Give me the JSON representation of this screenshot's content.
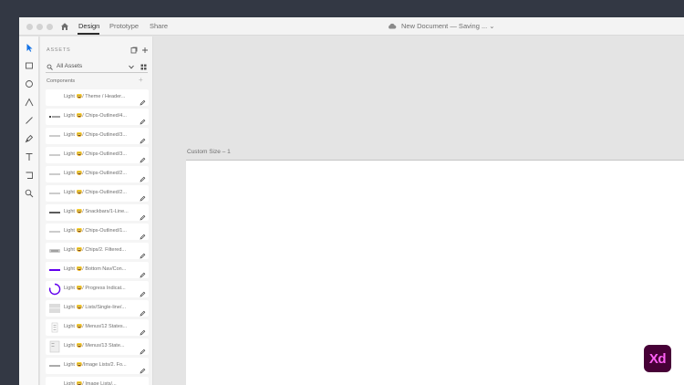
{
  "window": {
    "tabs": [
      {
        "label": "Design",
        "active": true
      },
      {
        "label": "Prototype",
        "active": false
      },
      {
        "label": "Share",
        "active": false
      }
    ],
    "document_title": "New Document  —  Saving ...  ⌄"
  },
  "assets": {
    "title": "ASSETS",
    "search_value": "All Assets",
    "components_heading": "Components",
    "components_add": "+",
    "items": [
      {
        "label": "Light 😀/ Theme / Header...",
        "thumb": "blank"
      },
      {
        "label": "Light 😀/ Chips-Outlined/4...",
        "thumb": "chip-dark"
      },
      {
        "label": "Light 😀/ Chips-Outlined/3...",
        "thumb": "chip-light"
      },
      {
        "label": "Light 😀/ Chips-Outlined/3...",
        "thumb": "chip-light"
      },
      {
        "label": "Light 😀/ Chips-Outlined/2...",
        "thumb": "chip-light"
      },
      {
        "label": "Light 😀/ Chips-Outlined/2...",
        "thumb": "chip-light"
      },
      {
        "label": "Light 😀/ Snackbars/1-Line...",
        "thumb": "bar-dark"
      },
      {
        "label": "Light 😀/ Chips-Outlined/1...",
        "thumb": "chip-light"
      },
      {
        "label": "Light 😀/ Chips/2. Filtered...",
        "thumb": "chip-filled"
      },
      {
        "label": "Light 😀/ Bottom Nav/Con...",
        "thumb": "bar-purple"
      },
      {
        "label": "Light 😀/ Progress Indicat...",
        "thumb": "progress"
      },
      {
        "label": "Light 😀/ Lists/Single-line/...",
        "thumb": "list"
      },
      {
        "label": "Light 😀/ Menus/12 States...",
        "thumb": "menu"
      },
      {
        "label": "Light 😀/ Menus/13 State...",
        "thumb": "menu2"
      },
      {
        "label": "Light 😀/Image Lists/2. Fo...",
        "thumb": "line-dark"
      },
      {
        "label": "Light 😀/ Image Lists/...",
        "thumb": "blank"
      }
    ]
  },
  "canvas": {
    "artboard_label": "Custom Size – 1"
  },
  "colors": {
    "accent": "#1473e6",
    "purple": "#6200ee",
    "xd_bg": "#470137",
    "xd_fg": "#ff61f6"
  },
  "logo": {
    "text": "Xd"
  }
}
